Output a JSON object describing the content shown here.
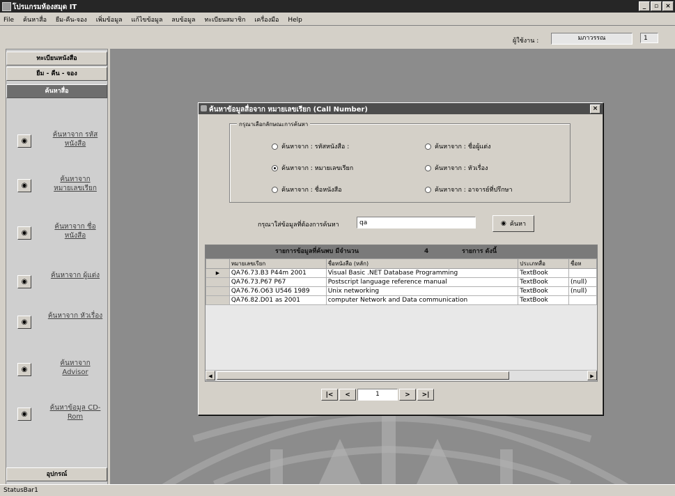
{
  "window": {
    "title": "โปรแกรมห้องสมุด IT",
    "min": "_",
    "max": "▫",
    "close": "×"
  },
  "menu": [
    "File",
    "ค้นหาสื่อ",
    "ยืม-คืน-จอง",
    "เพิ่มข้อมูล",
    "แก้ไขข้อมูล",
    "ลบข้อมูล",
    "ทะเบียนสมาชิก",
    "เครื่องมือ",
    "Help"
  ],
  "user": {
    "label": "ผู้ใช้งาน :",
    "name": "มภาวรรณ",
    "number": "1"
  },
  "sidebar": {
    "tabs": [
      "ทะเบียนหนังสือ",
      "ยืม - คืน - จอง",
      "ค้นหาสื่อ"
    ],
    "items": [
      {
        "icon": "binoculars-icon",
        "label": "ค้นหาจาก รหัสหนังสือ"
      },
      {
        "icon": "binoculars-icon",
        "label": "ค้นหาจาก หมายเลขเรียก"
      },
      {
        "icon": "binoculars-icon",
        "label": "ค้นหาจาก ชื่อหนังสือ"
      },
      {
        "icon": "binoculars-icon",
        "label": "ค้นหาจาก ผู้แต่ง"
      },
      {
        "icon": "binoculars-icon",
        "label": "ค้นหาจาก หัวเรื่อง"
      },
      {
        "icon": "binoculars-icon",
        "label": "ค้นหาจาก Advisor"
      },
      {
        "icon": "binoculars-icon",
        "label": "ค้นหาข้อมูล CD-Rom"
      }
    ],
    "footer": "อุปกรณ์"
  },
  "dialog": {
    "title": "ค้นหาข้อมูลสื่อจาก   หมายเลขเรียก  (Call Number)",
    "close": "×",
    "group_label": "กรุณาเลือกลักษณะการค้นหา",
    "radios": [
      {
        "label": "ค้นหาจาก : รหัสหนังสือ :",
        "checked": false
      },
      {
        "label": "ค้นหาจาก : หมายเลขเรียก",
        "checked": true
      },
      {
        "label": "ค้นหาจาก : ชื่อหนังสือ",
        "checked": false
      },
      {
        "label": "ค้นหาจาก : ชื่อผู้แต่ง",
        "checked": false
      },
      {
        "label": "ค้นหาจาก : หัวเรื่อง",
        "checked": false
      },
      {
        "label": "ค้นหาจาก : อาจารย์ที่ปรึกษา",
        "checked": false
      }
    ],
    "search_prompt": "กรุณาใส่ข้อมูลที่ต้องการค้นหา",
    "search_value": "qa",
    "search_button": "ค้นหา",
    "results_caption": {
      "prefix": "รายการข้อมูลที่ค้นพบ   มีจำนวน",
      "count": "4",
      "suffix": "รายการ  ดังนี้"
    },
    "columns": [
      "หมายเลขเรียก",
      "ชื่อหนังสือ (หลัก)",
      "ประเภทสื่อ",
      "ชื่อห"
    ],
    "rows": [
      {
        "marker": "▶",
        "cells": [
          "QA76.73.B3 P44m 2001",
          "Visual Basic .NET Database Programming",
          "TextBook",
          ""
        ]
      },
      {
        "marker": "",
        "cells": [
          "QA76.73.P67 P67",
          "Postscript language reference manual",
          "TextBook",
          "(null)"
        ]
      },
      {
        "marker": "",
        "cells": [
          "QA76.76.O63 U546  1989",
          "Unix networking",
          "TextBook",
          "(null)"
        ]
      },
      {
        "marker": "",
        "cells": [
          "QA76.82.D01 as 2001",
          "computer Network and Data communication",
          "TextBook",
          ""
        ]
      }
    ],
    "pager": {
      "first": "|<",
      "prev": "<",
      "page": "1",
      "next": ">",
      "last": ">|"
    }
  },
  "statusbar": "StatusBar1"
}
